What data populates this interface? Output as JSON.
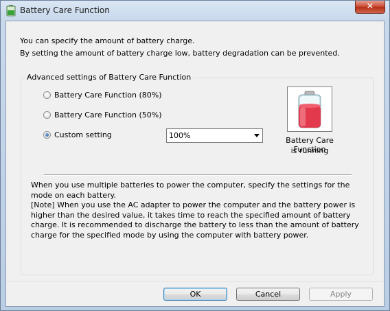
{
  "window": {
    "title": "Battery Care Function",
    "close_glyph": "✕"
  },
  "description": {
    "line1": "You can specify the amount of battery charge.",
    "line2": "By setting the amount of battery charge low, battery degradation can be prevented."
  },
  "group": {
    "legend": "Advanced settings of Battery Care Function",
    "options": [
      {
        "label": "Battery Care Function (80%)",
        "checked": false
      },
      {
        "label": "Battery Care Function (50%)",
        "checked": false
      },
      {
        "label": "Custom setting",
        "checked": true
      }
    ],
    "custom_value": "100%",
    "status_icon": "battery-icon",
    "status_line1": "Battery Care Function",
    "status_line2": "is running",
    "note_para1": "When you use multiple batteries to power the computer, specify the settings for the mode on each battery.",
    "note_para2": "[Note] When you use the AC adapter to power the computer and the battery power is higher than the desired value, it takes time to reach the specified amount of battery charge. It is recommended to discharge the battery to less than the amount of battery charge for the specified mode by using the computer with battery power."
  },
  "buttons": {
    "ok": "OK",
    "cancel": "Cancel",
    "apply": "Apply"
  },
  "colors": {
    "battery_level": "#e23a4c",
    "battery_body": "#c9e2ea"
  }
}
